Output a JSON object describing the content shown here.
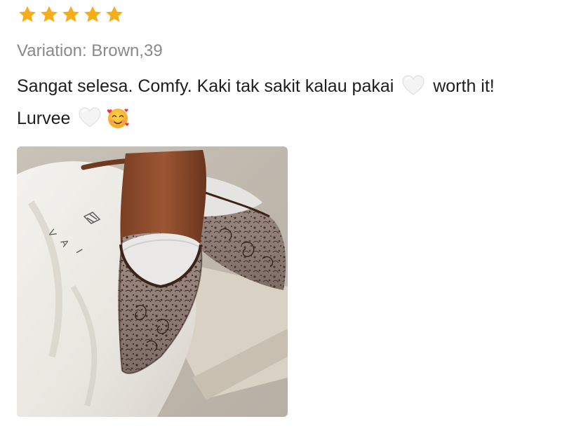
{
  "review": {
    "rating": 5,
    "rating_max": 5,
    "star_color": "#F6AD1A",
    "variation": "Variation: Brown,39",
    "comment_part1": "Sangat selesa. Comfy. Kaki tak sakit kalau pakai",
    "comment_part2": "worth it!",
    "comment_part3": "Lurvee",
    "emoji_1": "white-heart-emoji",
    "emoji_2": "white-heart-emoji",
    "emoji_3": "smiling-face-with-hearts-emoji",
    "photo": {
      "subject": "brown embellished mesh pointed heels on dust bag",
      "bag_logo_text": "VAI"
    }
  }
}
